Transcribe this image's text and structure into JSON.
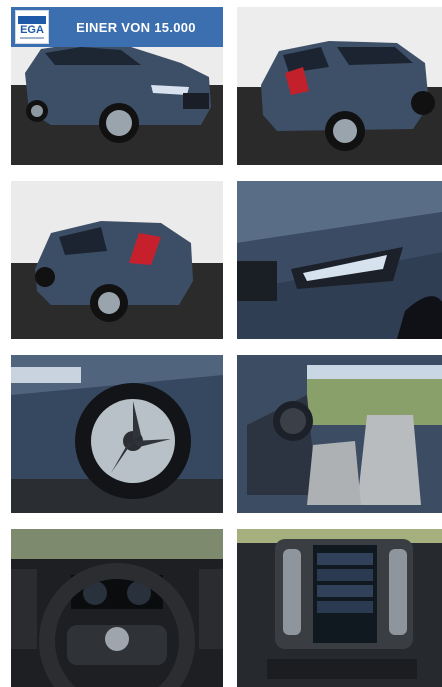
{
  "banner": {
    "logo_text": "EGA",
    "headline": "EINER VON 15.000"
  },
  "gallery": {
    "photos": [
      {
        "label": "front-left-exterior"
      },
      {
        "label": "rear-right-exterior"
      },
      {
        "label": "rear-left-exterior"
      },
      {
        "label": "headlight-detail"
      },
      {
        "label": "wheel-detail"
      },
      {
        "label": "front-seats-interior"
      },
      {
        "label": "steering-wheel-cockpit"
      },
      {
        "label": "infotainment-screen"
      }
    ]
  },
  "colors": {
    "banner_blue": "#3b6fb0",
    "car_body": "#3d4f66",
    "studio_wall": "#e9e9e9",
    "studio_floor": "#2a2a2a"
  }
}
